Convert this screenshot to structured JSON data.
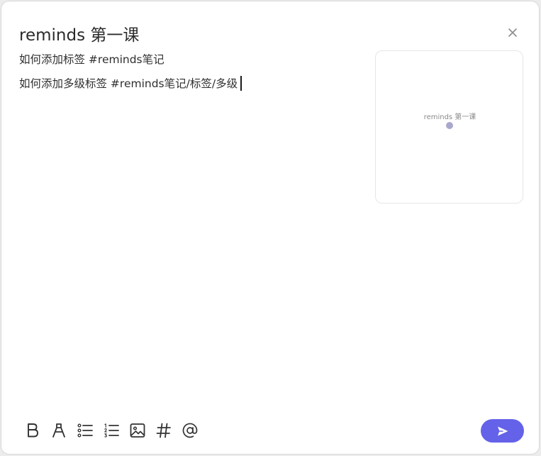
{
  "note": {
    "title": "reminds 第一课",
    "lines": [
      "如何添加标签 #reminds笔记",
      "如何添加多级标签 #reminds笔记/标签/多级"
    ]
  },
  "preview": {
    "node_label": "reminds 第一课"
  },
  "toolbar": {
    "icons": [
      "bold-icon",
      "highlight-icon",
      "bullet-list-icon",
      "numbered-list-icon",
      "image-icon",
      "hashtag-icon",
      "mention-icon"
    ]
  },
  "colors": {
    "accent": "#6462e8",
    "node": "#a9a8cc",
    "icon": "#333333",
    "close": "#8c8c8c"
  }
}
